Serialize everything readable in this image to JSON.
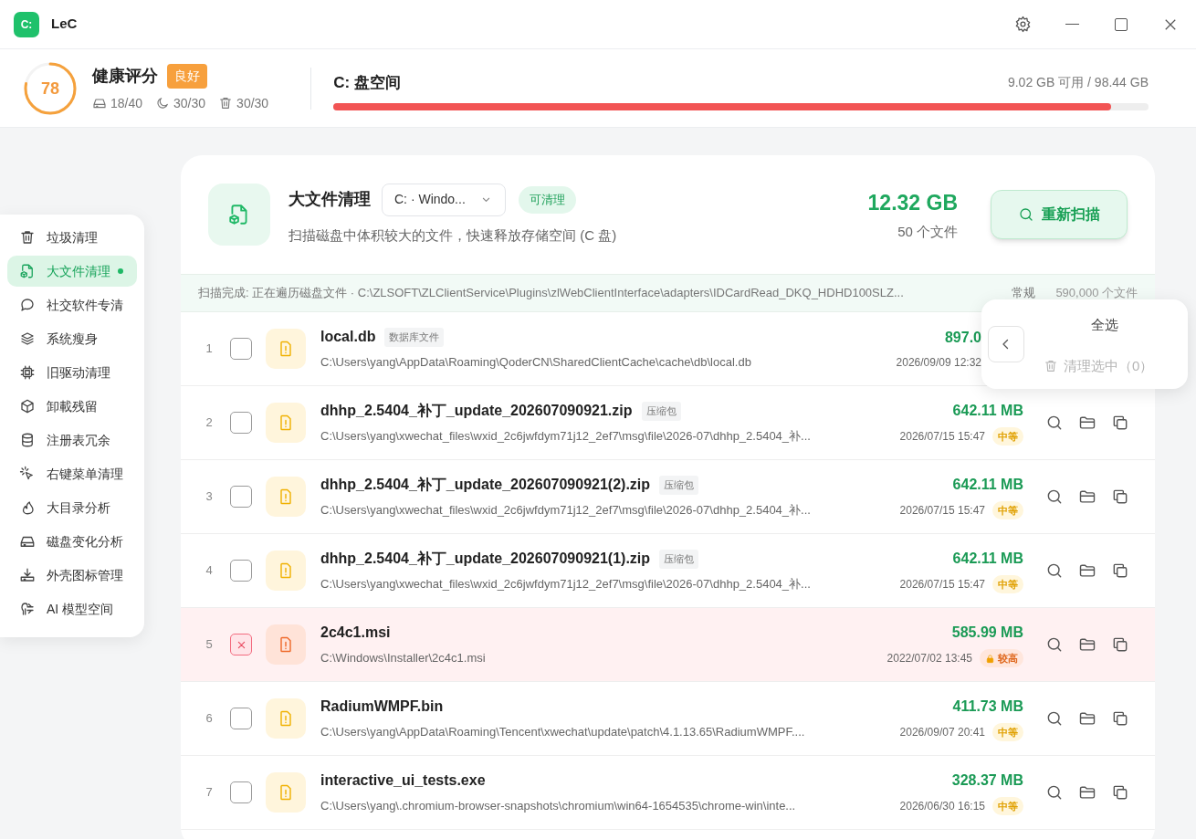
{
  "window": {
    "app_badge": "C:",
    "title": "LeC"
  },
  "health": {
    "score": "78",
    "title": "健康评分",
    "grade": "良好",
    "stats": [
      {
        "kind": "disk",
        "value": "18/40"
      },
      {
        "kind": "moon",
        "value": "30/30"
      },
      {
        "kind": "trash",
        "value": "30/30"
      }
    ]
  },
  "disk": {
    "title": "C: 盘空间",
    "summary": "9.02 GB 可用 / 98.44 GB",
    "level": 0.954
  },
  "sidebar": {
    "items": [
      {
        "label": "垃圾清理",
        "selected": false
      },
      {
        "label": "大文件清理",
        "selected": true
      },
      {
        "label": "社交软件专清",
        "selected": false
      },
      {
        "label": "系统瘦身",
        "selected": false
      },
      {
        "label": "旧驱动清理",
        "selected": false
      },
      {
        "label": "卸載残留",
        "selected": false
      },
      {
        "label": "注册表冗余",
        "selected": false
      },
      {
        "label": "右键菜单清理",
        "selected": false
      },
      {
        "label": "大目录分析",
        "selected": false
      },
      {
        "label": "磁盘变化分析",
        "selected": false
      },
      {
        "label": "外壳图标管理",
        "selected": false
      },
      {
        "label": "AI 模型空间",
        "selected": false
      }
    ]
  },
  "panel": {
    "title": "大文件清理",
    "drive_select": "C: · Windo...",
    "status": "可清理",
    "subtitle": "扫描磁盘中体积较大的文件，快速释放存储空间 (C 盘)",
    "total_size": "12.32 GB",
    "file_count": "50 个文件",
    "rescan_button": "重新扫描",
    "scan_status": "扫描完成: 正在遍历磁盘文件 · C:\\ZLSOFT\\ZLClientService\\Plugins\\zlWebClientInterface\\adapters\\IDCardRead_DKQ_HDHD100SLZ...",
    "scan_mode": "常规",
    "scanned_count": "590,000 个文件"
  },
  "files": [
    {
      "index": "1",
      "name": "local.db",
      "tag": "数据库文件",
      "path": "C:\\Users\\yang\\AppData\\Roaming\\QoderCN\\SharedClientCache\\cache\\db\\local.db",
      "size": "897.0",
      "date": "2026/09/09 12:32",
      "checked": false,
      "blocked": false,
      "actions": false
    },
    {
      "index": "2",
      "name": "dhhp_2.5404_补丁_update_202607090921.zip",
      "tag": "压缩包",
      "path": "C:\\Users\\yang\\xwechat_files\\wxid_2c6jwfdym71j12_2ef7\\msg\\file\\2026-07\\dhhp_2.5404_补...",
      "size": "642.11 MB",
      "date": "2026/07/15 15:47",
      "risk": "中等",
      "checked": false,
      "blocked": false,
      "actions": true
    },
    {
      "index": "3",
      "name": "dhhp_2.5404_补丁_update_202607090921(2).zip",
      "tag": "压缩包",
      "path": "C:\\Users\\yang\\xwechat_files\\wxid_2c6jwfdym71j12_2ef7\\msg\\file\\2026-07\\dhhp_2.5404_补...",
      "size": "642.11 MB",
      "date": "2026/07/15 15:47",
      "risk": "中等",
      "checked": false,
      "blocked": false,
      "actions": true
    },
    {
      "index": "4",
      "name": "dhhp_2.5404_补丁_update_202607090921(1).zip",
      "tag": "压缩包",
      "path": "C:\\Users\\yang\\xwechat_files\\wxid_2c6jwfdym71j12_2ef7\\msg\\file\\2026-07\\dhhp_2.5404_补...",
      "size": "642.11 MB",
      "date": "2026/07/15 15:47",
      "risk": "中等",
      "checked": false,
      "blocked": false,
      "actions": true
    },
    {
      "index": "5",
      "name": "2c4c1.msi",
      "path": "C:\\Windows\\Installer\\2c4c1.msi",
      "size": "585.99 MB",
      "date": "2022/07/02 13:45",
      "risk": "较高",
      "blocked": true,
      "actions": true
    },
    {
      "index": "6",
      "name": "RadiumWMPF.bin",
      "path": "C:\\Users\\yang\\AppData\\Roaming\\Tencent\\xwechat\\update\\patch\\4.1.13.65\\RadiumWMPF....",
      "size": "411.73 MB",
      "date": "2026/09/07 20:41",
      "risk": "中等",
      "checked": false,
      "blocked": false,
      "actions": true
    },
    {
      "index": "7",
      "name": "interactive_ui_tests.exe",
      "path": "C:\\Users\\yang\\.chromium-browser-snapshots\\chromium\\win64-1654535\\chrome-win\\inte...",
      "size": "328.37 MB",
      "date": "2026/06/30 16:15",
      "risk": "中等",
      "checked": false,
      "blocked": false,
      "actions": true
    }
  ],
  "selection_popup": {
    "select_all": "全选",
    "clean_selected": "清理选中（0）",
    "disabled": true
  }
}
